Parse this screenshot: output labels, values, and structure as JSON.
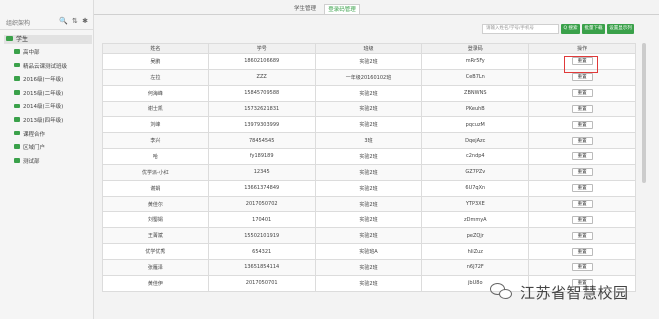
{
  "tabs": [
    {
      "label": "学生管理"
    },
    {
      "label": "登录码管理"
    }
  ],
  "sidebar": {
    "title": "组织架构",
    "tools": [
      "🔍",
      "⇅",
      "✱"
    ],
    "root": "学生",
    "items": [
      {
        "label": "高中部"
      },
      {
        "label": "精品云课测试班级"
      },
      {
        "label": "2016级(一年级)"
      },
      {
        "label": "2015级(二年级)"
      },
      {
        "label": "2014级(三年级)"
      },
      {
        "label": "2013级(四年级)"
      },
      {
        "label": "课程合作"
      },
      {
        "label": "区域门户"
      },
      {
        "label": "测试部"
      }
    ]
  },
  "toolbar": {
    "search_placeholder": "请输入姓名/学号/手机号",
    "search_label": "Q 搜索",
    "batch_download_label": "批量下载",
    "settings_label": "设置显示列"
  },
  "table": {
    "headers": [
      "姓名",
      "学号",
      "班级",
      "登录码",
      "操作"
    ],
    "action_label": "重置",
    "rows": [
      [
        "吴鹏",
        "18602106689",
        "实验2班",
        "mRr5Fy"
      ],
      [
        "左拉",
        "ZZZ",
        "一年级20160102班",
        "CeB7Ln"
      ],
      [
        "何海峰",
        "15845709588",
        "实验2班",
        "ZBNWNS"
      ],
      [
        "谢士凯",
        "15732621831",
        "实验2班",
        "PKeuhB"
      ],
      [
        "刘峰",
        "13979303999",
        "实验2班",
        "pqcuzM"
      ],
      [
        "李兴",
        "78454545",
        "3班",
        "DqejAzc"
      ],
      [
        "哈",
        "fy189189",
        "实验2班",
        "c2ndp4"
      ],
      [
        "优学派-小红",
        "12345",
        "实验2班",
        "GZ7PZv"
      ],
      [
        "谢娟",
        "13661374849",
        "实验2班",
        "6U7qXn"
      ],
      [
        "黄佳尔",
        "2017050702",
        "实验2班",
        "YTP3XE"
      ],
      [
        "刘蜀娟",
        "170401",
        "实验2班",
        "zDmmyA"
      ],
      [
        "王菁斌",
        "15502101919",
        "实验2班",
        "peZQjr"
      ],
      [
        "优学优秀",
        "654321",
        "实验班A",
        "hIiZuz"
      ],
      [
        "张雁泽",
        "13651854114",
        "实验2班",
        "n6J72F"
      ],
      [
        "黄佳伊",
        "2017050701",
        "实验2班",
        "jbU8o"
      ]
    ]
  },
  "watermark": {
    "text": "江苏省智慧校园"
  }
}
